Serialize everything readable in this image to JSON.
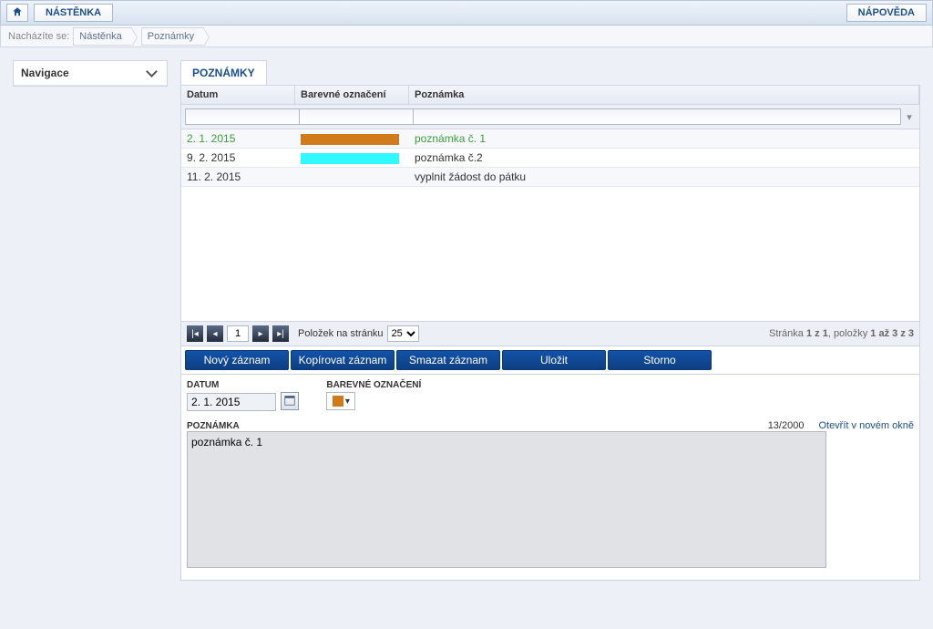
{
  "topbar": {
    "home_aria": "Home",
    "dashboard": "NÁSTĚNKA",
    "help": "NÁPOVĚDA"
  },
  "breadcrumb": {
    "label": "Nacházíte se:",
    "items": [
      "Nástěnka",
      "Poznámky"
    ]
  },
  "sidebar": {
    "title": "Navigace"
  },
  "tab": {
    "title": "POZNÁMKY"
  },
  "table": {
    "headers": {
      "date": "Datum",
      "color": "Barevné označení",
      "note": "Poznámka"
    },
    "rows": [
      {
        "date": "2. 1. 2015",
        "color": "#d07a1b",
        "note": "poznámka č. 1",
        "highlight": true
      },
      {
        "date": "9. 2. 2015",
        "color": "#2ff9ff",
        "note": "poznámka č.2",
        "highlight": false
      },
      {
        "date": "11. 2. 2015",
        "color": "",
        "note": "vyplnit žádost do pátku",
        "highlight": false
      }
    ]
  },
  "pager": {
    "page": "1",
    "per_page_label": "Položek na stránku",
    "per_page": "25",
    "summary_prefix": "Stránka ",
    "summary_pages": "1 z 1",
    "summary_mid": ", položky ",
    "summary_items": "1 až 3 z 3"
  },
  "actions": {
    "new": "Nový záznam",
    "copy": "Kopírovat záznam",
    "delete": "Smazat záznam",
    "save": "Uložit",
    "cancel": "Storno"
  },
  "form": {
    "date_label": "DATUM",
    "date_value": "2. 1. 2015",
    "color_label": "BAREVNÉ OZNAČENÍ",
    "color_value": "#d07a1b",
    "note_label": "POZNÁMKA",
    "note_count": "13/2000",
    "open_link": "Otevřít v novém okně",
    "note_value": "poznámka č. 1"
  }
}
